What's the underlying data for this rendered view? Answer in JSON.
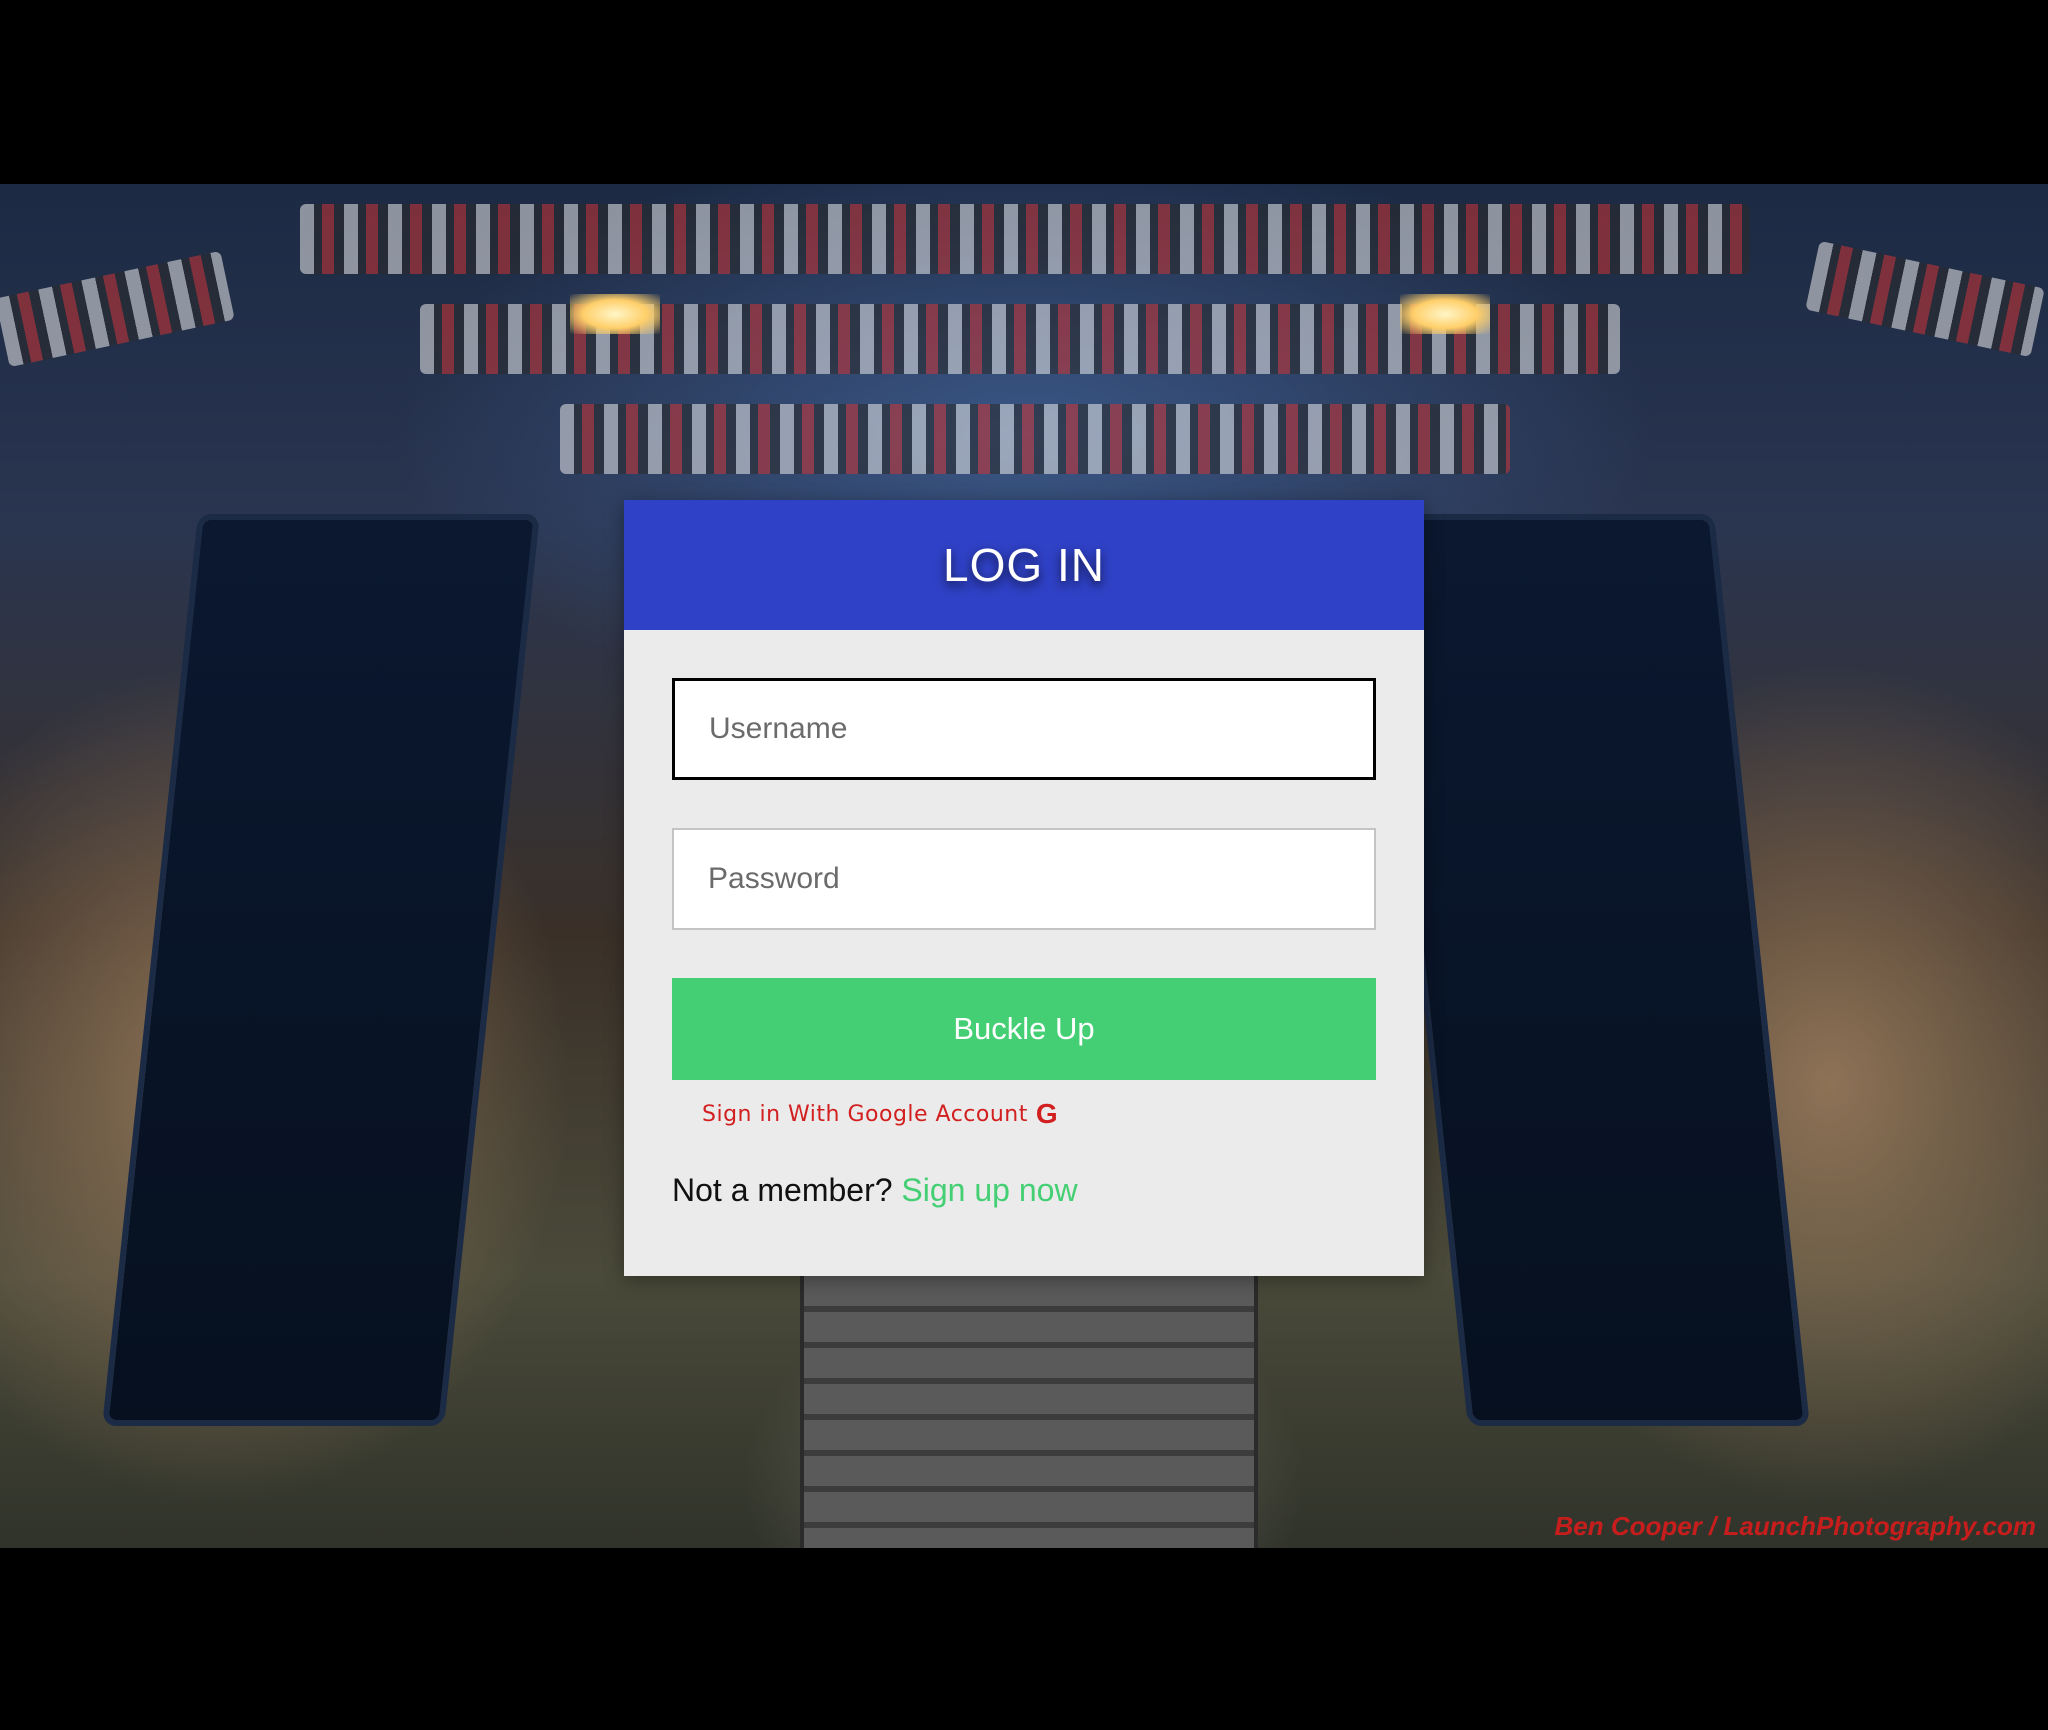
{
  "background": {
    "watermark": "Ben Cooper / LaunchPhotography.com"
  },
  "login": {
    "title": "LOG IN",
    "username_placeholder": "Username",
    "password_placeholder": "Password",
    "submit_label": "Buckle Up",
    "google_label": "Sign in With Google Account",
    "google_icon": "G",
    "signup_prompt": "Not a member?",
    "signup_link": "Sign up now"
  },
  "colors": {
    "header": "#2f41c6",
    "submit": "#45cf74",
    "google_link": "#d21f1f",
    "signup_link": "#45cf74",
    "card": "#ebebeb"
  }
}
